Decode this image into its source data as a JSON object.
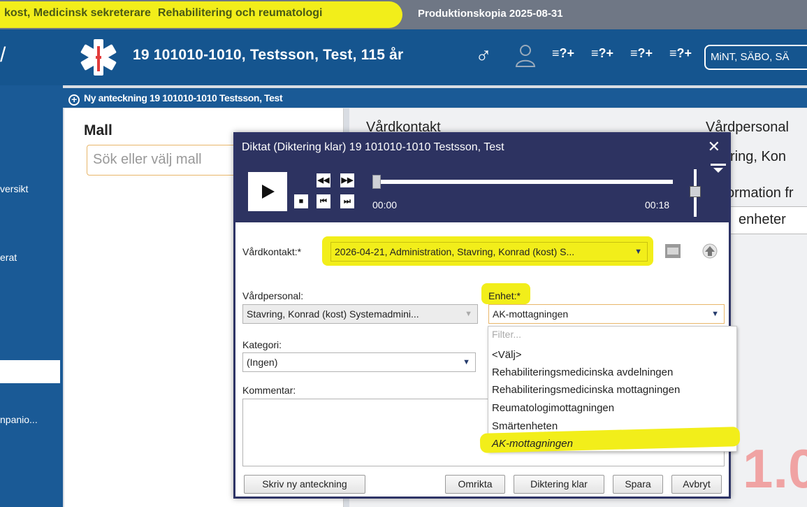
{
  "topbar": {
    "user": "kost, Medicinsk sekreterare",
    "unit": "Rehabilitering och reumatologi",
    "environment": "Produktionskopia 2025-08-31"
  },
  "patient": {
    "header": "19 101010-1010, Testsson, Test, 115 år",
    "gender_symbol": "♂",
    "shortcut_label": "≡?+",
    "mint": "MiNT, SÄBO, SÄ"
  },
  "leftnav": {
    "items": [
      "versikt",
      "erat",
      "npanio..."
    ]
  },
  "window": {
    "title": "Ny anteckning 19 101010-1010 Testsson, Test",
    "mall_label": "Mall",
    "mall_placeholder": "Sök eller välj mall",
    "vardkontakt_label": "Vårdkontakt",
    "vardpersonal_label": "Vårdpersonal",
    "vardpersonal_value": "vring, Kon",
    "information_label": "ormation fr",
    "enheter_value": "enheter",
    "big_text": "1.0"
  },
  "dialog": {
    "title": "Diktat (Diktering klar) 19 101010-1010 Testsson, Test",
    "close": "✕",
    "player": {
      "time_start": "00:00",
      "time_end": "00:18",
      "progress": 0
    },
    "vardkontakt_label": "Vårdkontakt:*",
    "vardkontakt_value": "2026-04-21, Administration, Stavring, Konrad (kost) S...",
    "vardpersonal_label": "Vårdpersonal:",
    "vardpersonal_value": "Stavring, Konrad (kost) Systemadmini...",
    "enhet_label": "Enhet:*",
    "enhet_value": "AK-mottagningen",
    "kategori_label": "Kategori:",
    "kategori_value": "(Ingen)",
    "kommentar_label": "Kommentar:",
    "buttons": {
      "skriv": "Skriv ny anteckning",
      "omrikta": "Omrikta",
      "diktering_klar": "Diktering klar",
      "spara": "Spara",
      "avbryt": "Avbryt"
    },
    "enhet_dropdown": {
      "filter_placeholder": "Filter...",
      "options": [
        "<Välj>",
        "Rehabiliteringsmedicinska avdelningen",
        "Rehabiliteringsmedicinska mottagningen",
        "Reumatologimottagningen",
        "Smärtenheten",
        "AK-mottagningen"
      ],
      "selected_index": 5
    }
  },
  "colors": {
    "highlight": "#f2ee1a",
    "brand_blue": "#15558f",
    "dialog_navy": "#2d3361"
  }
}
